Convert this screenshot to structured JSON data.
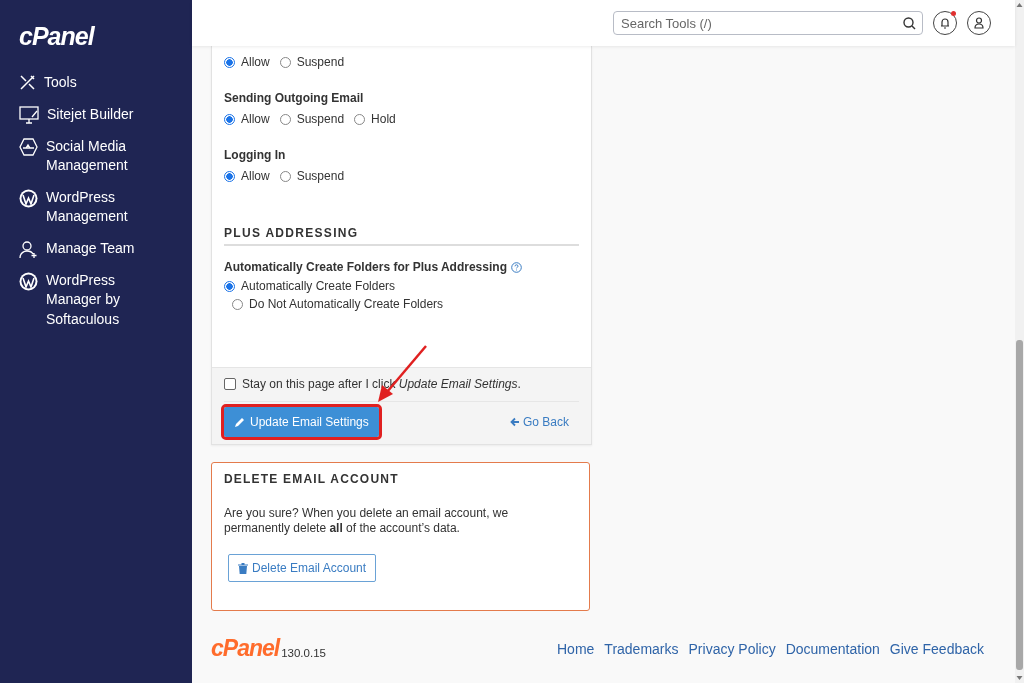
{
  "sidebar": {
    "logo": "cPanel",
    "items": [
      {
        "label": "Tools",
        "kind": "tools"
      },
      {
        "label": "Sitejet Builder",
        "kind": "monitor"
      },
      {
        "label": "Social Media Management",
        "kind": "social"
      },
      {
        "label": "WordPress Management",
        "kind": "wordpress"
      },
      {
        "label": "Manage Team",
        "kind": "team"
      },
      {
        "label": "WordPress Manager by Softaculous",
        "kind": "wordpress"
      }
    ]
  },
  "header": {
    "search": {
      "placeholder": "Search Tools (/)"
    },
    "notifications": {
      "unread": true
    }
  },
  "settings": {
    "groups": [
      {
        "options": [
          {
            "label": "Allow",
            "selected": true
          },
          {
            "label": "Suspend",
            "selected": false
          }
        ]
      },
      {
        "label": "Sending Outgoing Email",
        "options": [
          {
            "label": "Allow",
            "selected": true
          },
          {
            "label": "Suspend",
            "selected": false
          },
          {
            "label": "Hold",
            "selected": false
          }
        ]
      },
      {
        "label": "Logging In",
        "options": [
          {
            "label": "Allow",
            "selected": true
          },
          {
            "label": "Suspend",
            "selected": false
          }
        ]
      }
    ],
    "plus_addressing": {
      "heading": "PLUS ADDRESSING",
      "question": "Automatically Create Folders for Plus Addressing",
      "options": [
        {
          "label": "Automatically Create Folders",
          "selected": true
        },
        {
          "label": "Do Not Automatically Create Folders",
          "selected": false
        }
      ]
    },
    "stay_checkbox": {
      "label": "Stay on this page after I click *Update Email Settings*.",
      "checked": false
    },
    "update_button": {
      "label": "Update Email Settings",
      "highlighted": true
    },
    "go_back": "Go Back"
  },
  "delete_account": {
    "heading": "DELETE EMAIL ACCOUNT",
    "text": "Are you sure? When you delete an email account, we permanently delete **all** of the account’s data.",
    "button": "Delete Email Account"
  },
  "footer": {
    "logo": "cPanel",
    "version": "130.0.15",
    "links": [
      "Home",
      "Trademarks",
      "Privacy Policy",
      "Documentation",
      "Give Feedback"
    ]
  }
}
